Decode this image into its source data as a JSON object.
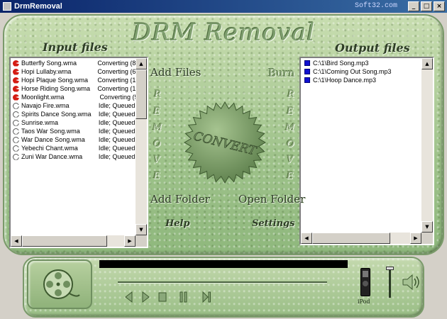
{
  "window": {
    "title": "DrmRemoval",
    "watermark": "Soft32.com",
    "minimize": "_",
    "maximize": "□",
    "close": "×"
  },
  "app_title": "DRM Removal",
  "input_panel": {
    "heading": "Input files",
    "rows": [
      {
        "name": "Butterfly Song.wma",
        "status": "Converting (83",
        "state": "converting"
      },
      {
        "name": "Hopi Lullaby.wma",
        "status": "Converting (64",
        "state": "converting"
      },
      {
        "name": "Hopi Plaque Song.wma",
        "status": "Converting (16",
        "state": "converting"
      },
      {
        "name": "Horse Riding Song.wma",
        "status": "Converting (13",
        "state": "converting"
      },
      {
        "name": "Moonlight.wma",
        "status": "Converting (5",
        "state": "converting"
      },
      {
        "name": "Navajo Fire.wma",
        "status": "Idle; Queued f",
        "state": "queued"
      },
      {
        "name": "Spirits Dance Song.wma",
        "status": "Idle; Queued f",
        "state": "queued"
      },
      {
        "name": "Sunrise.wma",
        "status": "Idle; Queued f",
        "state": "queued"
      },
      {
        "name": "Taos War Song.wma",
        "status": "Idle; Queued f",
        "state": "queued"
      },
      {
        "name": "War Dance Song.wma",
        "status": "Idle; Queued f",
        "state": "queued"
      },
      {
        "name": "Yebechi Chant.wma",
        "status": "Idle; Queued f",
        "state": "queued"
      },
      {
        "name": "Zuni War Dance.wma",
        "status": "Idle; Queued f",
        "state": "queued"
      }
    ]
  },
  "output_panel": {
    "heading": "Output files",
    "rows": [
      {
        "name": "C:\\1\\Bird Song.mp3"
      },
      {
        "name": "C:\\1\\Coming Out Song.mp3"
      },
      {
        "name": "C:\\1\\Hoop Dance.mp3"
      }
    ]
  },
  "buttons": {
    "add_files": "Add Files",
    "burn": "Burn",
    "remove_letters": [
      "R",
      "E",
      "M",
      "O",
      "V",
      "E"
    ],
    "convert": "CONVERT",
    "add_folder": "Add Folder",
    "open_folder": "Open Folder",
    "help": "Help",
    "settings": "Settings"
  },
  "player": {
    "ipod_label": "iPod"
  },
  "colors": {
    "skin": "#a8c994",
    "converting_icon": "#d41b12",
    "output_icon": "#1010d0"
  }
}
